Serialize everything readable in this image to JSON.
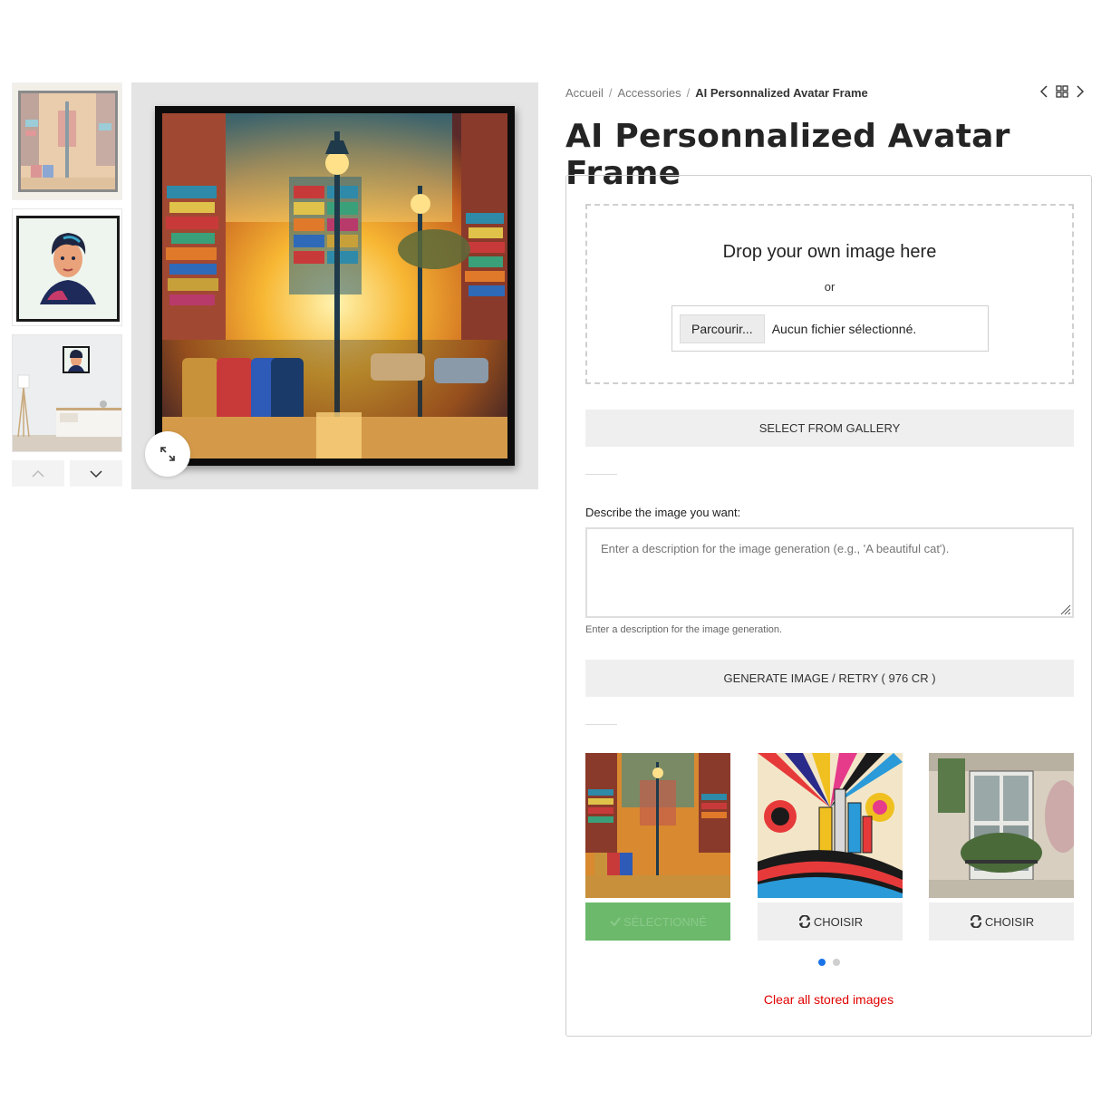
{
  "breadcrumb": {
    "items": [
      "Accueil",
      "Accessories"
    ],
    "separator": "/",
    "current": "AI Personnalized Avatar Frame"
  },
  "product": {
    "title": "AI Personnalized Avatar Frame"
  },
  "upload": {
    "drop_title": "Drop your own image here",
    "or_text": "or",
    "browse_label": "Parcourir...",
    "file_status": "Aucun fichier sélectionné."
  },
  "actions": {
    "gallery_button": "SELECT FROM GALLERY",
    "generate_button": "GENERATE IMAGE / RETRY  ( 976 CR )"
  },
  "description": {
    "label": "Describe the image you want:",
    "placeholder": "Enter a description for the image generation (e.g., 'A beautiful cat').",
    "help": "Enter a description for the image generation."
  },
  "generated": {
    "items": [
      {
        "button": "SÉLECTIONNÉ",
        "state": "selected",
        "icon": "check-icon"
      },
      {
        "button": "CHOISIR",
        "state": "choose",
        "icon": "refresh-icon"
      },
      {
        "button": "CHOISIR",
        "state": "choose",
        "icon": "refresh-icon"
      }
    ],
    "pages": 2,
    "active_page": 1,
    "clear_label": "Clear all stored images"
  },
  "colors": {
    "selected_green": "#6cb96c",
    "link_red": "#e00000",
    "dot_active": "#1a73e8"
  }
}
